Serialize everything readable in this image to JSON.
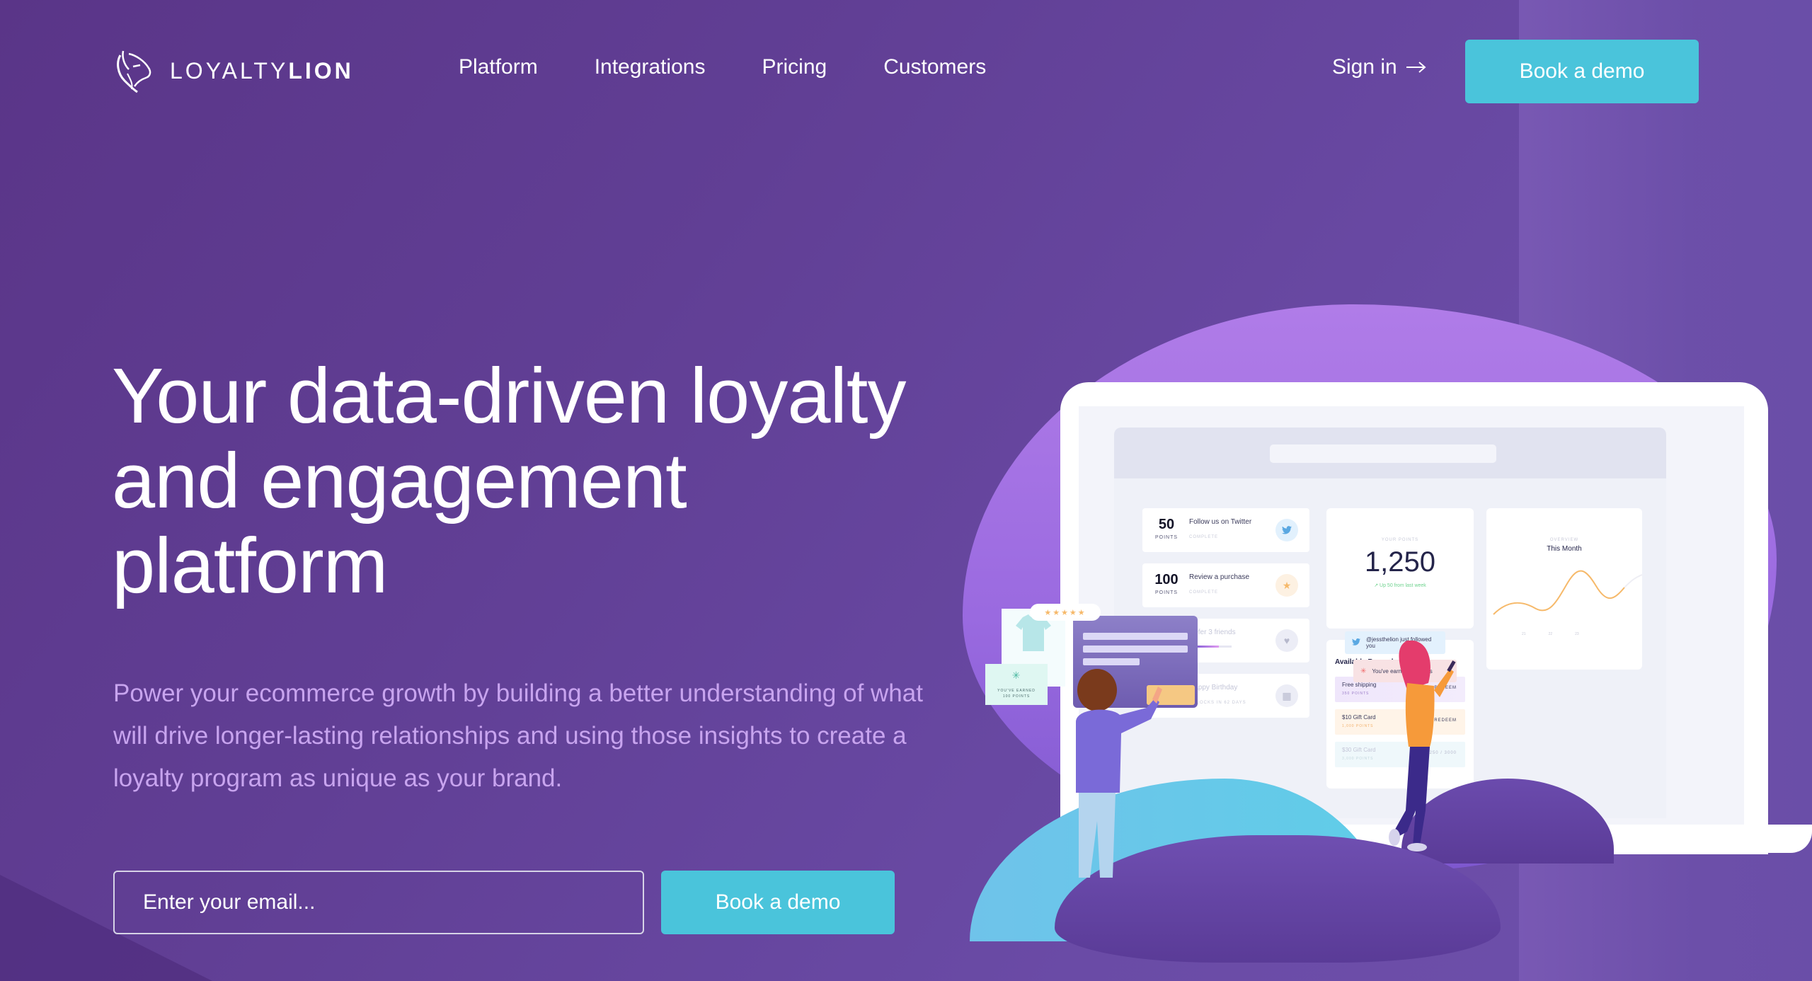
{
  "brand": {
    "name_light": "LOYALTY",
    "name_bold": "LION",
    "logo_icon": "lion-head-icon"
  },
  "nav": {
    "links": [
      {
        "label": "Platform"
      },
      {
        "label": "Integrations"
      },
      {
        "label": "Pricing"
      },
      {
        "label": "Customers"
      }
    ],
    "signin_label": "Sign in",
    "signin_icon": "arrow-right-icon",
    "cta_label": "Book a demo"
  },
  "hero": {
    "title_lines": [
      "Your data-driven loyalty",
      "and engagement",
      "platform"
    ],
    "subtitle": "Power your ecommerce growth by building a better understanding of what will drive longer-lasting relationships and using those insights to create a loyalty program as unique as your brand.",
    "email_placeholder": "Enter your email...",
    "email_value": "",
    "cta_label": "Book a demo"
  },
  "colors": {
    "background": "#5e3a8f",
    "accent": "#4ac4db",
    "subtitle": "#c8a4ef",
    "chart_line": "#f6b96a",
    "trend_up": "#6fd38f"
  },
  "illustration": {
    "tasks": [
      {
        "points": "50",
        "points_label": "POINTS",
        "title": "Follow us on Twitter",
        "status": "COMPLETE",
        "icon": "twitter-icon"
      },
      {
        "points": "100",
        "points_label": "POINTS",
        "title": "Review a purchase",
        "status": "COMPLETE",
        "icon": "star-icon"
      },
      {
        "points": "",
        "points_label": "",
        "title": "Refer 3 friends",
        "status": "",
        "icon": "heart-icon"
      },
      {
        "points": "",
        "points_label": "POINTS",
        "title": "Happy Birthday",
        "status": "UNLOCKS IN 62 DAYS",
        "icon": "gift-icon"
      }
    ],
    "points_card": {
      "label": "YOUR POINTS",
      "value": "1,250",
      "trend": "Up 50 from last week"
    },
    "overview_card": {
      "label": "OVERVIEW",
      "title": "This Month",
      "ticks": [
        "21",
        "22",
        "23"
      ]
    },
    "rewards": {
      "title": "Available Rewards",
      "items": [
        {
          "name": "Free shipping",
          "cost": "350 POINTS",
          "action": "REDEEM"
        },
        {
          "name": "$10 Gift Card",
          "cost": "1,000 POINTS",
          "action": "REDEEM"
        },
        {
          "name": "$30 Gift Card",
          "cost": "3,000 POINTS",
          "action": "1250 / 3000"
        }
      ]
    },
    "toasts": [
      {
        "text": "@jessthelion just followed you",
        "icon": "twitter-icon"
      },
      {
        "text": "You've earned 50 points",
        "icon": "sparkle-icon"
      }
    ],
    "earned_card": {
      "line1": "YOU'VE EARNED",
      "line2": "100 POINTS"
    },
    "stars": "★★★★★"
  }
}
